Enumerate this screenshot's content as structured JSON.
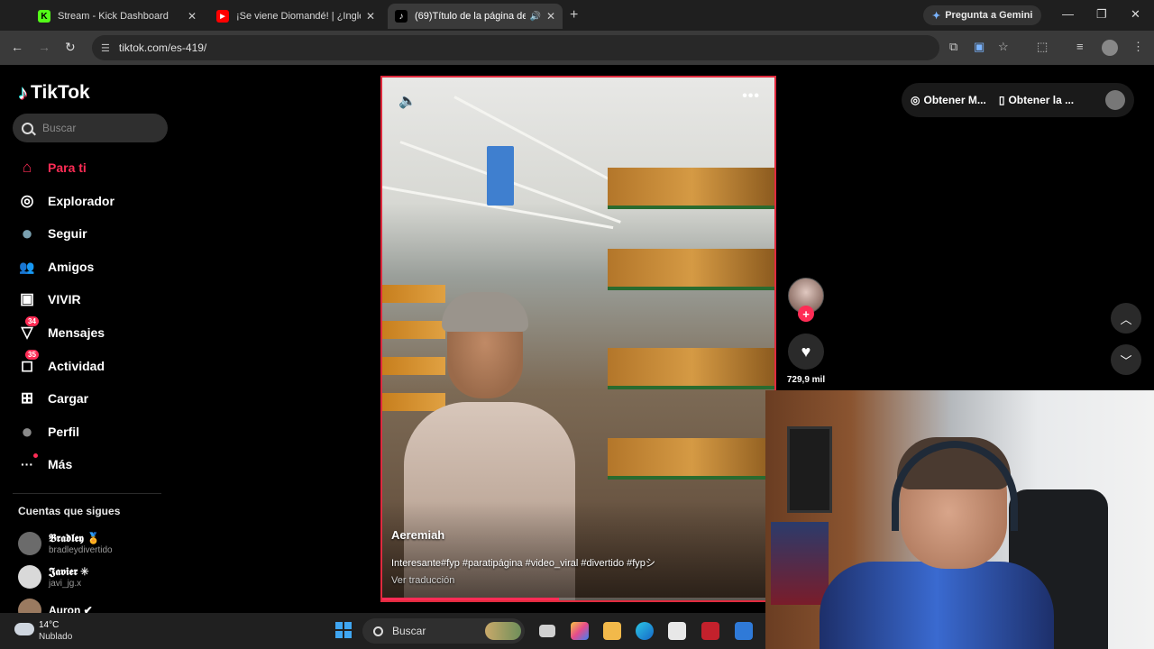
{
  "browser": {
    "tabs": [
      {
        "title": "Stream - Kick Dashboard",
        "favicon": "K",
        "color": "#53fc18"
      },
      {
        "title": "¡Se viene Diomandé! | ¿Inglesa",
        "favicon": "▶",
        "color": "#ff0000"
      },
      {
        "title": "(69)Título de la página de",
        "favicon": "♪",
        "color": "#000000"
      }
    ],
    "gemini_label": "Pregunta a Gemini",
    "url": "tiktok.com/es-419/"
  },
  "tiktok": {
    "logo_text": "TikTok",
    "search_placeholder": "Buscar",
    "menu": [
      {
        "label": "Para ti",
        "icon": "home-icon",
        "glyph": "⌂"
      },
      {
        "label": "Explorador",
        "icon": "compass-icon",
        "glyph": "◎"
      },
      {
        "label": "Seguir",
        "icon": "following-avatar-icon",
        "glyph": "●"
      },
      {
        "label": "Amigos",
        "icon": "friends-icon",
        "glyph": "👥"
      },
      {
        "label": "VIVIR",
        "icon": "live-icon",
        "glyph": "▣"
      },
      {
        "label": "Mensajes",
        "icon": "messages-icon",
        "glyph": "▽",
        "badge": "34"
      },
      {
        "label": "Actividad",
        "icon": "activity-icon",
        "glyph": "◻",
        "badge": "35"
      },
      {
        "label": "Cargar",
        "icon": "upload-icon",
        "glyph": "⊞"
      },
      {
        "label": "Perfil",
        "icon": "profile-avatar-icon",
        "glyph": "●"
      },
      {
        "label": "Más",
        "icon": "more-icon",
        "glyph": "···"
      }
    ],
    "following_title": "Cuentas que sigues",
    "following": [
      {
        "name": "𝕭𝖗𝖆𝖉𝖑𝖊𝖞 🏅",
        "handle": "bradleydivertido"
      },
      {
        "name": "𝕵𝖆𝖛𝖎𝖊𝖗 ✳",
        "handle": "javi_jg.x"
      },
      {
        "name": "Auron ✔",
        "handle": ""
      }
    ],
    "video": {
      "author": "Aeremiah",
      "caption": "Interesante#fyp #paratipágina #video_viral #divertido #fypシ",
      "translate_label": "Ver traducción",
      "progress": 0.45
    },
    "likes": "729,9 mil",
    "top_right": {
      "item1": "Obtener M...",
      "item2": "Obtener la ..."
    }
  },
  "taskbar": {
    "temperature": "14°C",
    "condition": "Nublado",
    "search_label": "Buscar"
  }
}
